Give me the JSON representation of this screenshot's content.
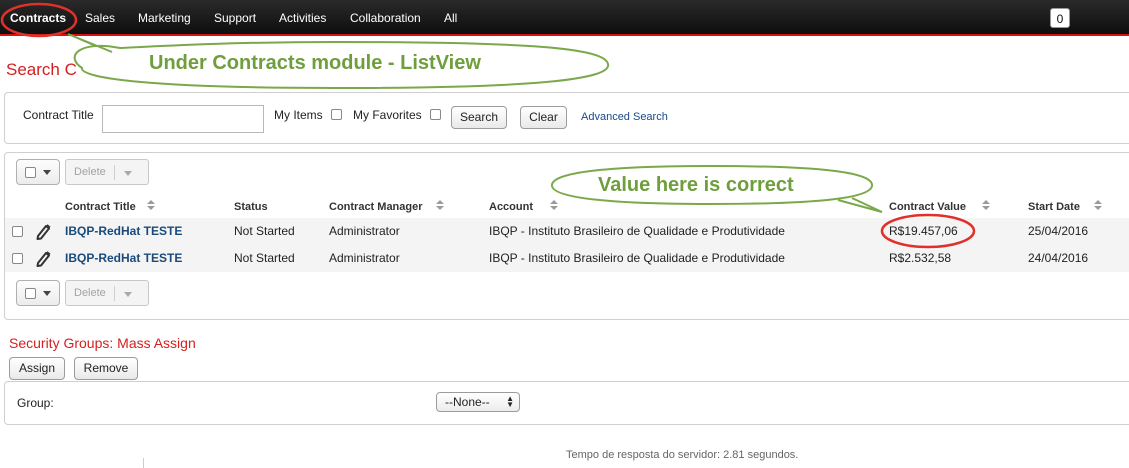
{
  "nav": {
    "items": [
      "Contracts",
      "Sales",
      "Marketing",
      "Support",
      "Activities",
      "Collaboration",
      "All"
    ],
    "notification_count": "0"
  },
  "search": {
    "heading": "Search C",
    "contract_title_label": "Contract Title",
    "contract_title_value": "",
    "my_items_label": "My Items",
    "my_favorites_label": "My Favorites",
    "search_button": "Search",
    "clear_button": "Clear",
    "advanced_search_link": "Advanced Search"
  },
  "list": {
    "delete_label": "Delete",
    "columns": [
      "Contract Title",
      "Status",
      "Contract Manager",
      "Account",
      "Contract Value",
      "Start Date"
    ],
    "rows": [
      {
        "title": "IBQP-RedHat TESTE",
        "status": "Not Started",
        "manager": "Administrator",
        "account": "IBQP - Instituto Brasileiro de Qualidade e Produtividade",
        "value": "R$19.457,06",
        "start_date": "25/04/2016"
      },
      {
        "title": "IBQP-RedHat TESTE",
        "status": "Not Started",
        "manager": "Administrator",
        "account": "IBQP - Instituto Brasileiro de Qualidade e Produtividade",
        "value": "R$2.532,58",
        "start_date": "24/04/2016"
      }
    ]
  },
  "security": {
    "heading": "Security Groups: Mass Assign",
    "assign_button": "Assign",
    "remove_button": "Remove",
    "group_label": "Group:",
    "group_selected": "--None--"
  },
  "footer": {
    "response_time": "Tempo de resposta do servidor: 2.81 segundos."
  },
  "annotations": {
    "module_note": "Under Contracts module - ListView",
    "value_note": "Value here is correct",
    "color": "#6f9e3c",
    "highlight_color": "#e0302a"
  },
  "colors": {
    "accent_red": "#d42020",
    "link_blue": "#1a4a8a",
    "nav_bg": "#111111"
  }
}
